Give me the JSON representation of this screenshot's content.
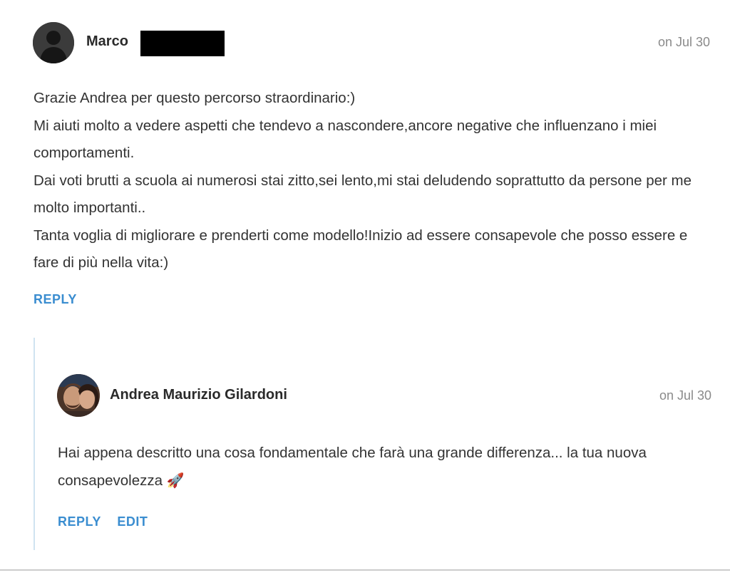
{
  "comment": {
    "author": "Marco",
    "date": "on Jul 30",
    "lines": [
      "Grazie Andrea per questo percorso straordinario:)",
      "Mi aiuti molto a vedere aspetti che tendevo a nascondere,ancore negative che influenzano i miei comportamenti.",
      "Dai voti brutti a scuola ai numerosi stai zitto,sei lento,mi stai deludendo soprattutto da persone per me molto importanti..",
      "Tanta voglia di migliorare e prenderti come modello!Inizio ad essere consapevole che posso essere e fare di più nella vita:)"
    ],
    "reply_label": "REPLY"
  },
  "reply": {
    "author": "Andrea Maurizio Gilardoni",
    "date": "on Jul 30",
    "text": "Hai appena descritto una cosa fondamentale che farà una grande differenza... la tua nuova consapevolezza",
    "emoji": "🚀",
    "reply_label": "REPLY",
    "edit_label": "EDIT"
  },
  "colors": {
    "link": "#3a8dd0",
    "thread_border": "#cfe3f1",
    "date": "#8a8a8a"
  }
}
